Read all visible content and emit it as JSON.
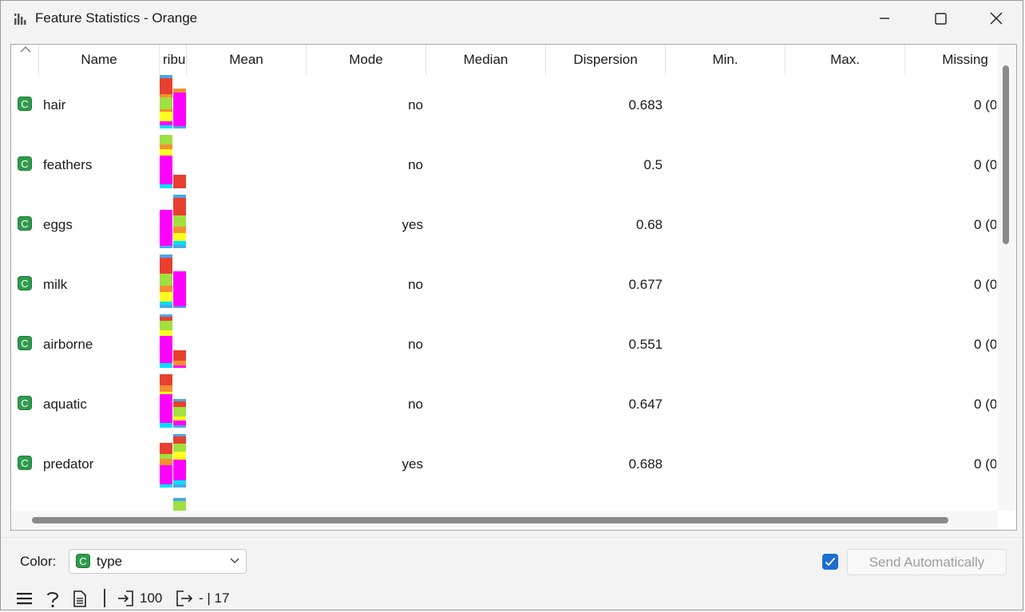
{
  "window": {
    "title": "Feature Statistics - Orange",
    "app_icon": "bar-chart-icon",
    "controls": [
      "minimize-icon",
      "maximize-icon",
      "close-icon"
    ]
  },
  "table": {
    "columns": [
      "Name",
      "ribu",
      "Mean",
      "Mode",
      "Median",
      "Dispersion",
      "Min.",
      "Max.",
      "Missing"
    ],
    "sort_indicator": "chevron-up-icon",
    "row_type_badge": "C",
    "rows": [
      {
        "name": "hair",
        "mode": "no",
        "dispersion": "0.683",
        "missing": "0 (0"
      },
      {
        "name": "feathers",
        "mode": "no",
        "dispersion": "0.5",
        "missing": "0 (0"
      },
      {
        "name": "eggs",
        "mode": "yes",
        "dispersion": "0.68",
        "missing": "0 (0"
      },
      {
        "name": "milk",
        "mode": "no",
        "dispersion": "0.677",
        "missing": "0 (0"
      },
      {
        "name": "airborne",
        "mode": "no",
        "dispersion": "0.551",
        "missing": "0 (0"
      },
      {
        "name": "aquatic",
        "mode": "no",
        "dispersion": "0.647",
        "missing": "0 (0"
      },
      {
        "name": "predator",
        "mode": "yes",
        "dispersion": "0.688",
        "missing": "0 (0"
      }
    ],
    "class_colors": {
      "mammal": "#ff00ff",
      "fish": "#00e0ff",
      "bird": "#ffd700",
      "invertebrate": "#e84030",
      "insect": "#a0e040",
      "amphibian": "#f59030",
      "reptile": "#ffff20",
      "blue": "#4aa8e8"
    }
  },
  "controls": {
    "color_label": "Color:",
    "color_badge": "C",
    "color_value": "type",
    "send_auto_checked": true,
    "send_auto_label": "Send Automatically"
  },
  "status": {
    "menu_icon": "hamburger-icon",
    "help_icon": "help-icon",
    "report_icon": "report-icon",
    "input_icon": "input-icon",
    "input_count": "100",
    "output_icon": "output-icon",
    "output_text": "- | 17"
  }
}
